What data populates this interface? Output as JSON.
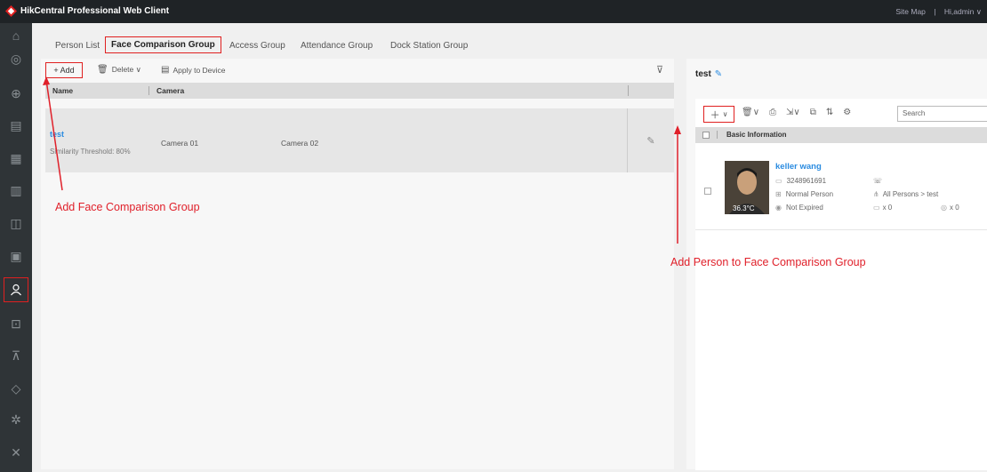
{
  "app": {
    "title": "HikCentral Professional Web Client",
    "site_map": "Site Map",
    "user": "Hi,admin ∨",
    "divider": "|"
  },
  "tabs": [
    {
      "label": "Person List"
    },
    {
      "label": "Face Comparison Group"
    },
    {
      "label": "Access Group"
    },
    {
      "label": "Attendance Group"
    },
    {
      "label": "Dock Station Group"
    }
  ],
  "left_toolbar": {
    "add": "+ Add",
    "delete": "Delete ∨",
    "apply": "Apply to Device"
  },
  "table": {
    "headers": {
      "name": "Name",
      "camera": "Camera"
    },
    "row": {
      "name": "test",
      "threshold": "Similarity Threshold: 80%",
      "camera1": "Camera 01",
      "camera2": "Camera 02"
    }
  },
  "right": {
    "title": "test",
    "search_placeholder": "Search",
    "header": "Basic Information",
    "person": {
      "name": "keller wang",
      "phone_id": "3248961691",
      "type": "Normal Person",
      "status": "Not Expired",
      "group_path": "All Persons > test",
      "card_count": "x 0",
      "fp_count": "x 0",
      "temperature": "36.3°C"
    }
  },
  "annotations": {
    "left": "Add Face Comparison Group",
    "right": "Add Person to Face Comparison Group"
  },
  "colors": {
    "accent": "#e02020",
    "link": "#2a8be0",
    "topbar": "#1f2326",
    "sidebar": "#2f3437"
  }
}
